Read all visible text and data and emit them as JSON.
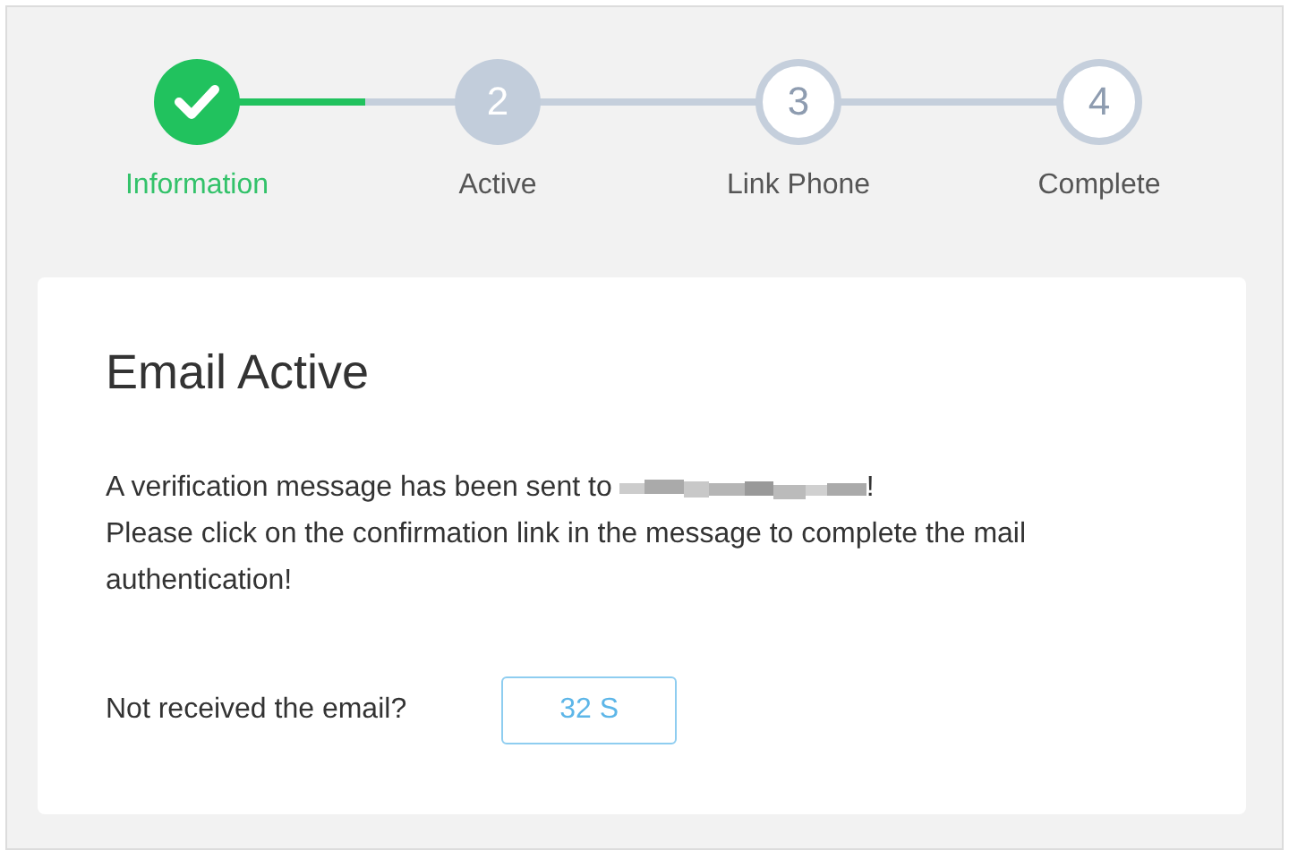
{
  "steps": [
    {
      "label": "Information",
      "kind": "done"
    },
    {
      "number": "2",
      "label": "Active",
      "kind": "current"
    },
    {
      "number": "3",
      "label": "Link Phone",
      "kind": "pending"
    },
    {
      "number": "4",
      "label": "Complete",
      "kind": "pending"
    }
  ],
  "connectors": [
    {
      "level": 0.56
    },
    {
      "level": 0
    },
    {
      "level": 0
    }
  ],
  "card": {
    "title": "Email Active",
    "message_start": "A verification message has been sent to",
    "message_end": "!",
    "instruction": "Please click on the confirmation link in the message to complete the mail authentication!",
    "resend_prompt": "Not received the email?",
    "resend_button": {
      "label": "32 S"
    }
  }
}
